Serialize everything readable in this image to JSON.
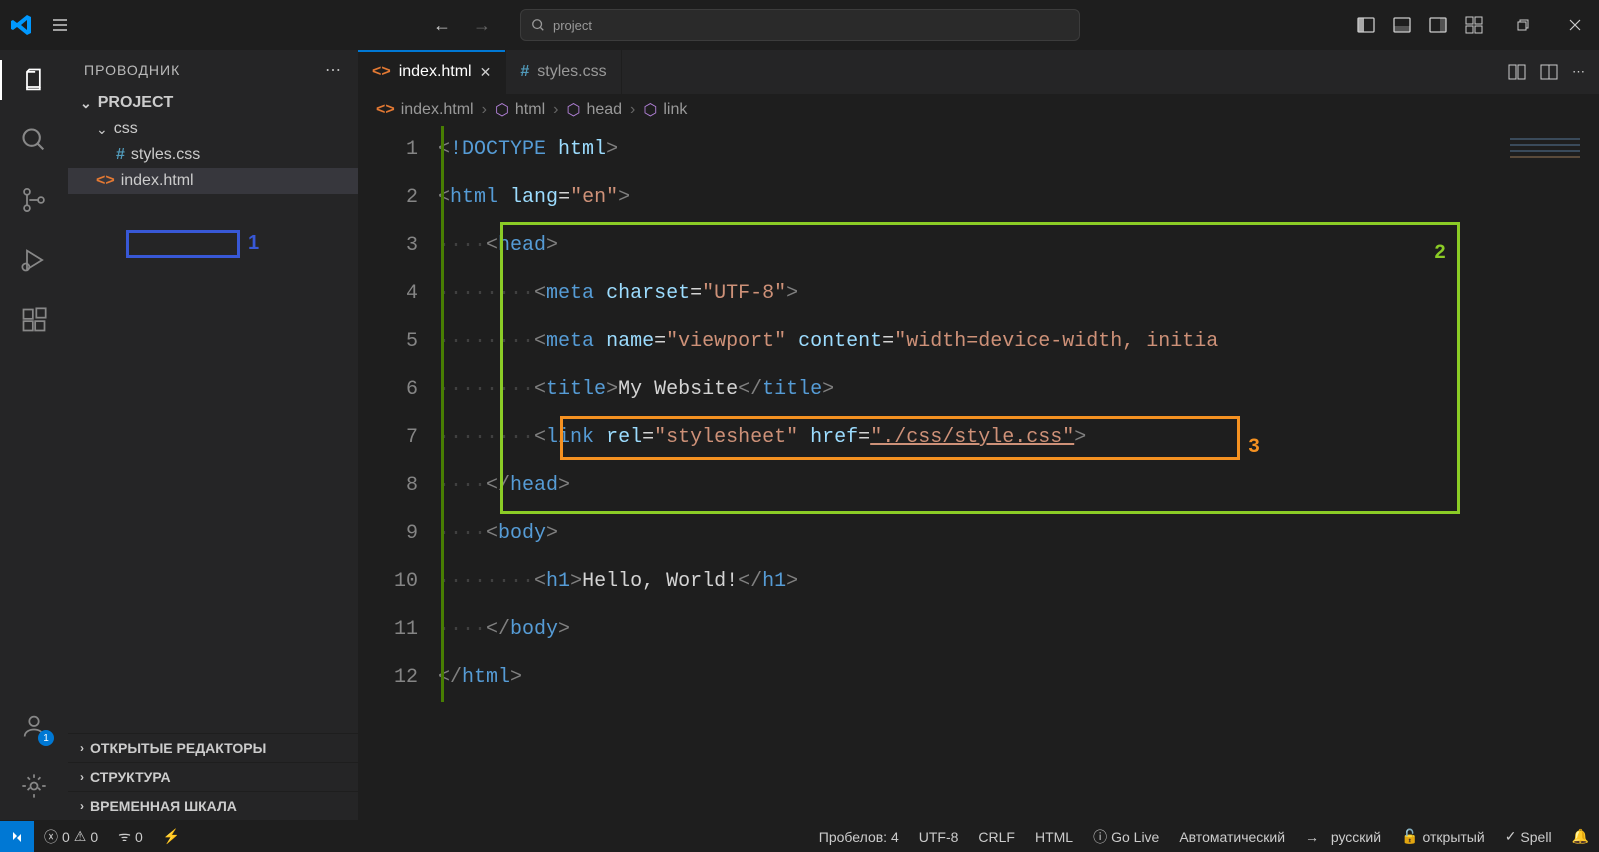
{
  "titlebar": {
    "search_placeholder": "project"
  },
  "sidebar": {
    "title": "ПРОВОДНИК",
    "project_name": "PROJECT",
    "folder_css": "css",
    "file_styles": "styles.css",
    "file_index": "index.html",
    "panels": {
      "open_editors": "ОТКРЫТЫЕ РЕДАКТОРЫ",
      "outline": "СТРУКТУРА",
      "timeline": "ВРЕМЕННАЯ ШКАЛА"
    }
  },
  "tabs": {
    "tab1": "index.html",
    "tab2": "styles.css"
  },
  "breadcrumbs": {
    "b1": "index.html",
    "b2": "html",
    "b3": "head",
    "b4": "link"
  },
  "code": {
    "lines": [
      "1",
      "2",
      "3",
      "4",
      "5",
      "6",
      "7",
      "8",
      "9",
      "10",
      "11",
      "12"
    ],
    "l1": {
      "doctype": "!DOCTYPE",
      "html": "html"
    },
    "l2": {
      "tag": "html",
      "attr": "lang",
      "val": "\"en\""
    },
    "l3": {
      "tag": "head"
    },
    "l4": {
      "tag": "meta",
      "a1": "charset",
      "v1": "\"UTF-8\""
    },
    "l5": {
      "tag": "meta",
      "a1": "name",
      "v1": "\"viewport\"",
      "a2": "content",
      "v2": "\"width=device-width, initia"
    },
    "l6": {
      "open": "title",
      "text": "My Website",
      "close": "title"
    },
    "l7": {
      "tag": "link",
      "a1": "rel",
      "v1": "\"stylesheet\"",
      "a2": "href",
      "v2": "\"./css/style.css\""
    },
    "l8": {
      "tag": "head"
    },
    "l9": {
      "tag": "body"
    },
    "l10": {
      "open": "h1",
      "text": "Hello, World!",
      "close": "h1"
    },
    "l11": {
      "tag": "body"
    },
    "l12": {
      "tag": "html"
    }
  },
  "statusbar": {
    "errors": "0",
    "warnings": "0",
    "ports": "0",
    "spaces": "Пробелов: 4",
    "encoding": "UTF-8",
    "eol": "CRLF",
    "lang": "HTML",
    "golive": "Go Live",
    "auto": "Автоматический",
    "russian": "русский",
    "open": "открытый",
    "spell": "Spell"
  },
  "badges": {
    "accounts": "1"
  },
  "annotations": {
    "a1": "1",
    "a2": "2",
    "a3": "3"
  }
}
